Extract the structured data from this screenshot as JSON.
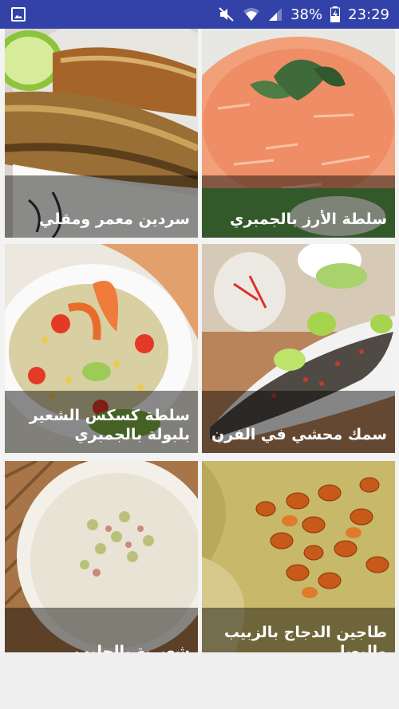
{
  "status_bar": {
    "battery_percent": "38%",
    "time": "23:29",
    "icons": [
      "image-icon",
      "mute-icon",
      "wifi-icon",
      "signal-icon",
      "battery-icon"
    ]
  },
  "recipes": [
    {
      "title": "سردين معمر ومقلي"
    },
    {
      "title": "سلطة الأرز بالجمبري"
    },
    {
      "title": "سلطة كسكس الشعير بلبولة بالجمبري"
    },
    {
      "title": "سمك محشي في الفرن"
    },
    {
      "title": "شعيرية بالحليب"
    },
    {
      "title": "طاجين الدجاج بالزبيب والبصل"
    }
  ],
  "colors": {
    "status_bar": "#3342a8",
    "overlay": "rgba(0,0,0,0.45)"
  }
}
